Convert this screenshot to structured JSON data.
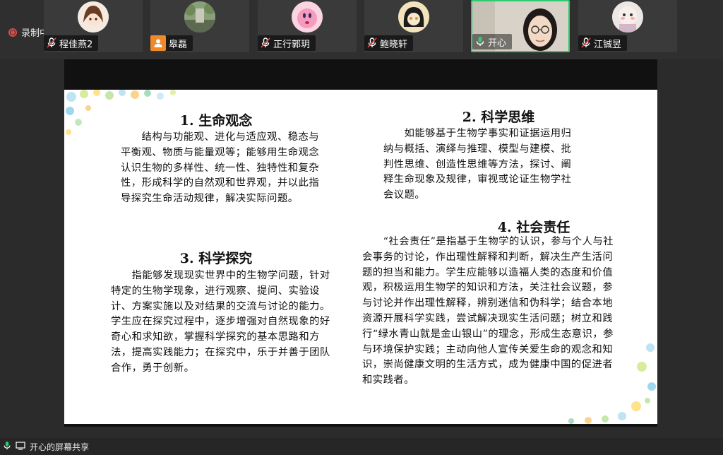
{
  "recording": {
    "label": "录制中"
  },
  "participants": [
    {
      "name": "程佳燕2"
    },
    {
      "name": "皋磊"
    },
    {
      "name": "正行郭玥"
    },
    {
      "name": "鲍晓轩"
    },
    {
      "name": "开心"
    },
    {
      "name": "江铖昱"
    }
  ],
  "slide": {
    "s1": {
      "title": "1. 生命观念",
      "body": "　　结构与功能观、进化与适应观、稳态与平衡观、物质与能量观等；能够用生命观念认识生物的多样性、统一性、独特性和复杂性，形成科学的自然观和世界观，并以此指导探究生命活动规律，解决实际问题。"
    },
    "s2": {
      "title": "2. 科学思维",
      "body": "　　如能够基于生物学事实和证据运用归纳与概括、演绎与推理、模型与建模、批判性思维、创造性思维等方法，探讨、阐释生命现象及规律，审视或论证生物学社会议题。"
    },
    "s3": {
      "title": "3. 科学探究",
      "body": "　　指能够发现现实世界中的生物学问题，针对特定的生物学现象，进行观察、提问、实验设计、方案实施以及对结果的交流与讨论的能力。学生应在探究过程中，逐步增强对自然现象的好奇心和求知欲，掌握科学探究的基本思路和方法，提高实践能力；在探究中，乐于并善于团队合作，勇于创新。"
    },
    "s4": {
      "title": "4. 社会责任",
      "body": "　　“社会责任”是指基于生物学的认识，参与个人与社会事务的讨论，作出理性解释和判断，解决生产生活问题的担当和能力。学生应能够以造福人类的态度和价值观，积极运用生物学的知识和方法，关注社会议题，参与讨论并作出理性解释，辨别迷信和伪科学；结合本地资源开展科学实践，尝试解决现实生活问题；树立和践行“绿水青山就是金山银山”的理念，形成生态意识，参与环境保护实践；主动向他人宣传关爱生命的观念和知识，崇尚健康文明的生活方式，成为健康中国的促进者和实践者。"
    }
  },
  "share_status": {
    "label": "开心的屏幕共享"
  },
  "colors": {
    "accent_green": "#2ecc71",
    "record_red": "#e24a4a",
    "muted_mic": "#ffffff"
  }
}
